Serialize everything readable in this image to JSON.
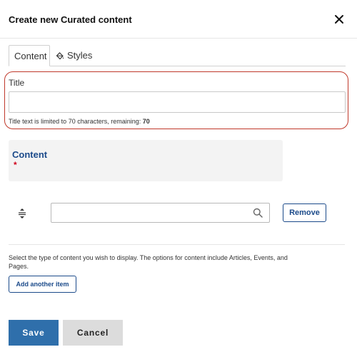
{
  "dialog": {
    "title": "Create new Curated content",
    "close_icon": "close-icon"
  },
  "tabs": [
    {
      "label": "Content",
      "active": true
    },
    {
      "label": "Styles",
      "icon": "paint-bucket-icon",
      "active": false
    }
  ],
  "title_field": {
    "label": "Title",
    "value": "",
    "hint_prefix": "Title text is limited to 70 characters, remaining: ",
    "remaining": "70"
  },
  "content_section": {
    "label": "Content",
    "required_marker": "*"
  },
  "content_item": {
    "drag_icon": "drag-handle-icon",
    "search_value": "",
    "search_icon": "search-icon",
    "remove_label": "Remove"
  },
  "help_text": "Select the type of content you wish to display. The options for content include Articles, Events, and Pages.",
  "add_item_label": "Add another item",
  "actions": {
    "save_label": "Save",
    "cancel_label": "Cancel"
  },
  "colors": {
    "primary": "#2f6fab",
    "link_blue": "#1b4a8a",
    "highlight": "#c0392b",
    "required": "#d0021b",
    "panel_bg": "#f3f3f3"
  }
}
